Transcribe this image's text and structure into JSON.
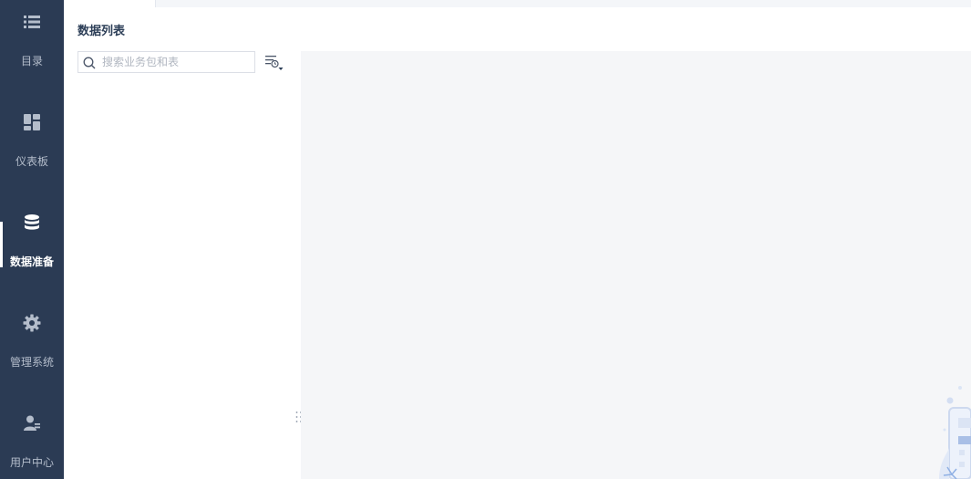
{
  "nav": {
    "items": [
      {
        "label": "目录",
        "icon": "catalog-list-icon"
      },
      {
        "label": "仪表板",
        "icon": "dashboard-grid-icon"
      },
      {
        "label": "数据准备",
        "icon": "database-icon",
        "active": true
      },
      {
        "label": "管理系统",
        "icon": "gear-icon"
      },
      {
        "label": "用户中心",
        "icon": "user-icon"
      }
    ]
  },
  "panel": {
    "title": "数据列表",
    "search_placeholder": "搜索业务包和表",
    "filter_icon": "filter-list-icon"
  },
  "colors": {
    "nav_bg": "#2b3b54",
    "nav_text": "#b4bdcb",
    "nav_active_text": "#ffffff",
    "main_bg": "#f5f6f8",
    "title_text": "#2c3e57"
  }
}
